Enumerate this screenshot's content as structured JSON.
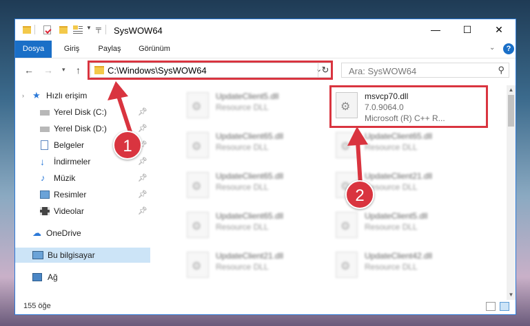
{
  "window": {
    "title": "SysWOW64"
  },
  "ribbon": {
    "tabs": [
      "Dosya",
      "Giriş",
      "Paylaş",
      "Görünüm"
    ]
  },
  "address": {
    "path": "C:\\Windows\\SysWOW64"
  },
  "search": {
    "placeholder": "Ara: SysWOW64"
  },
  "sidebar": {
    "items": [
      {
        "label": "Hızlı erişim",
        "icon": "star-icon"
      },
      {
        "label": "Yerel Disk (C:)",
        "icon": "drive-icon"
      },
      {
        "label": "Yerel Disk (D:)",
        "icon": "drive-icon"
      },
      {
        "label": "Belgeler",
        "icon": "documents-icon"
      },
      {
        "label": "İndirmeler",
        "icon": "download-icon"
      },
      {
        "label": "Müzik",
        "icon": "music-icon"
      },
      {
        "label": "Resimler",
        "icon": "pictures-icon"
      },
      {
        "label": "Videolar",
        "icon": "videos-icon"
      },
      {
        "label": "OneDrive",
        "icon": "cloud-icon"
      },
      {
        "label": "Bu bilgisayar",
        "icon": "computer-icon"
      },
      {
        "label": "Ağ",
        "icon": "network-icon"
      }
    ]
  },
  "files": [
    {
      "name": "UpdateClient5.dll",
      "type": "Resource DLL"
    },
    {
      "name": "msvcp70.dll",
      "version": "7.0.9064.0",
      "desc": "Microsoft (R) C++ R..."
    },
    {
      "name": "UpdateClient65.dll",
      "type": "Resource DLL"
    },
    {
      "name": "UpdateClient65.dll",
      "type": "Resource DLL"
    },
    {
      "name": "UpdateClient65.dll",
      "type": "Resource DLL"
    },
    {
      "name": "UpdateClient21.dll",
      "type": "Resource DLL"
    },
    {
      "name": "UpdateClient65.dll",
      "type": "Resource DLL"
    },
    {
      "name": "UpdateClient5.dll",
      "type": "Resource DLL"
    },
    {
      "name": "UpdateClient21.dll",
      "type": "Resource DLL"
    },
    {
      "name": "UpdateClient42.dll",
      "type": "Resource DLL"
    }
  ],
  "status": {
    "count": "155 öğe"
  },
  "annotations": {
    "badge1": "1",
    "badge2": "2"
  },
  "colors": {
    "highlight": "#d9343f",
    "ribbon_file": "#1a6fc7",
    "selected": "#cce4f7"
  }
}
